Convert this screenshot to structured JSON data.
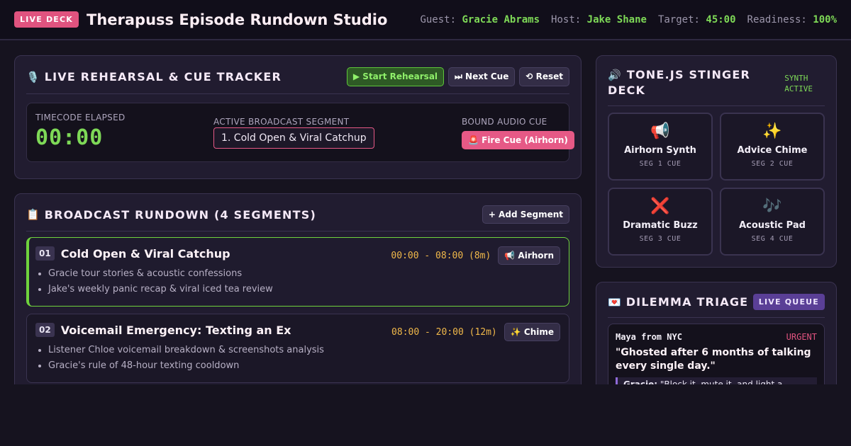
{
  "header": {
    "badge": "LIVE DECK",
    "title": "Therapuss Episode Rundown Studio",
    "guest_label": "Guest:",
    "guest": "Gracie Abrams",
    "host_label": "Host:",
    "host": "Jake Shane",
    "target_label": "Target:",
    "target": "45:00",
    "readiness_label": "Readiness:",
    "readiness": "100%"
  },
  "tracker": {
    "icon": "🎙️",
    "title": "LIVE REHEARSAL & CUE TRACKER",
    "start_label": "▶ Start Rehearsal",
    "next_label": "⏭ Next Cue",
    "reset_label": "⟲ Reset",
    "timecode_label": "TIMECODE ELAPSED",
    "timecode": "00:00",
    "segment_label": "ACTIVE BROADCAST SEGMENT",
    "segment_value": "1. Cold Open & Viral Catchup",
    "audio_label": "BOUND AUDIO CUE",
    "fire_label": "🚨 Fire Cue (Airhorn)"
  },
  "rundown": {
    "icon": "📋",
    "title": "BROADCAST RUNDOWN (4 SEGMENTS)",
    "add_label": "+ Add Segment",
    "segments": [
      {
        "num": "01",
        "title": "Cold Open & Viral Catchup",
        "time": "00:00 - 08:00 (8m)",
        "cue": "📢 Airhorn",
        "bullets": [
          "Gracie tour stories & acoustic confessions",
          "Jake's weekly panic recap & viral iced tea review"
        ]
      },
      {
        "num": "02",
        "title": "Voicemail Emergency: Texting an Ex",
        "time": "08:00 - 20:00 (12m)",
        "cue": "✨ Chime",
        "bullets": [
          "Listener Chloe voicemail breakdown & screenshots analysis",
          "Gracie's rule of 48-hour texting cooldown"
        ]
      }
    ]
  },
  "stingers": {
    "icon": "🔊",
    "title_line1": "TONE.JS STINGER",
    "title_line2": "DECK",
    "status_line1": "SYNTH",
    "status_line2": "ACTIVE",
    "items": [
      {
        "emoji": "📢",
        "name": "Airhorn Synth",
        "sub": "SEG 1 CUE"
      },
      {
        "emoji": "✨",
        "name": "Advice Chime",
        "sub": "SEG 2 CUE"
      },
      {
        "emoji": "❌",
        "name": "Dramatic Buzz",
        "sub": "SEG 3 CUE"
      },
      {
        "emoji": "🎶",
        "name": "Acoustic Pad",
        "sub": "SEG 4 CUE"
      }
    ]
  },
  "triage": {
    "icon": "💌",
    "title": "DILEMMA TRIAGE",
    "badge": "LIVE QUEUE",
    "caller": "Maya from NYC",
    "priority": "URGENT",
    "quote": "\"Ghosted after 6 months of talking every single day.\"",
    "reply_prefix": "Gracie:",
    "reply": "\"Block it, mute it, and light a candle.\""
  },
  "colors": {
    "accent_green": "#7ed957",
    "accent_pink": "#e65986",
    "accent_purple": "#5a3f96",
    "time_amber": "#f0b84a",
    "urgent_red": "#e0537f"
  }
}
